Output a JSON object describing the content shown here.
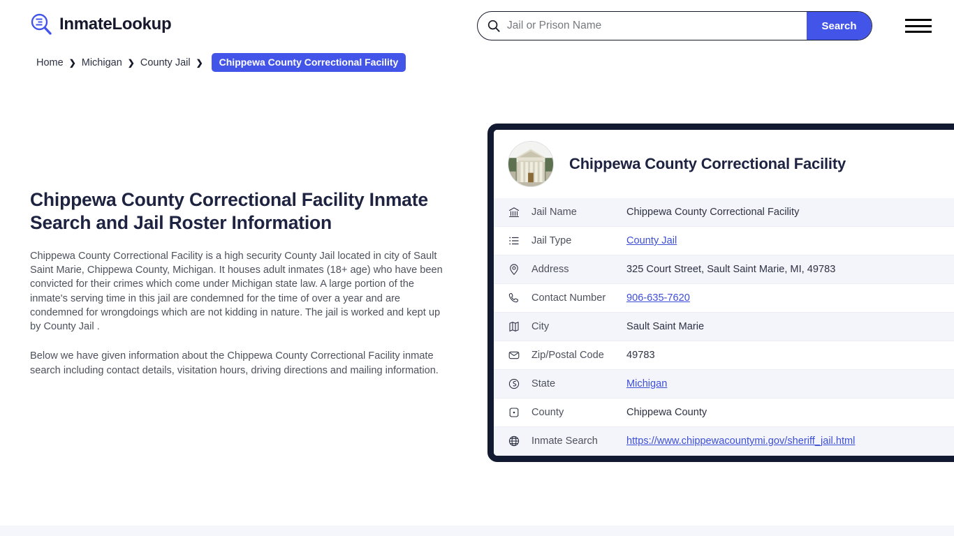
{
  "header": {
    "logo_text": "InmateLookup",
    "logo_icon": "magnifier-list-icon",
    "search": {
      "placeholder": "Jail or Prison Name",
      "value": "",
      "icon": "search-icon",
      "button_label": "Search"
    },
    "menu_icon": "hamburger-menu-icon"
  },
  "breadcrumb": {
    "items": [
      {
        "label": "Home"
      },
      {
        "label": "Michigan"
      },
      {
        "label": "County Jail"
      }
    ],
    "separator": "❯",
    "current": "Chippewa County Correctional Facility"
  },
  "main": {
    "page_title": "Chippewa County Correctional Facility Inmate Search and Jail Roster Information",
    "paragraph_1": "Chippewa County Correctional Facility is a high security County Jail located in city of Sault Saint Marie, Chippewa County, Michigan. It houses adult inmates (18+ age) who have been convicted for their crimes which come under Michigan state law. A large portion of the inmate's serving time in this jail are condemned for the time of over a year and are condemned for wrongdoings which are not kidding in nature. The jail is worked and kept up by County Jail .",
    "paragraph_2": "Below we have given information about the Chippewa County Correctional Facility inmate search including contact details, visitation hours, driving directions and mailing information."
  },
  "card": {
    "avatar_icon": "courthouse-photo",
    "title": "Chippewa County Correctional Facility",
    "rows": [
      {
        "icon": "bank-icon",
        "label": "Jail Name",
        "value": "Chippewa County Correctional Facility",
        "link": false
      },
      {
        "icon": "list-icon",
        "label": "Jail Type",
        "value": "County Jail",
        "link": true
      },
      {
        "icon": "map-pin-icon",
        "label": "Address",
        "value": "325 Court Street, Sault Saint Marie, MI, 49783",
        "link": false
      },
      {
        "icon": "phone-icon",
        "label": "Contact Number",
        "value": "906-635-7620",
        "link": true
      },
      {
        "icon": "map-icon",
        "label": "City",
        "value": "Sault Saint Marie",
        "link": false
      },
      {
        "icon": "envelope-icon",
        "label": "Zip/Postal Code",
        "value": "49783",
        "link": false
      },
      {
        "icon": "globe-state-icon",
        "label": "State",
        "value": "Michigan",
        "link": true
      },
      {
        "icon": "county-icon",
        "label": "County",
        "value": "Chippewa County",
        "link": false
      },
      {
        "icon": "globe-icon",
        "label": "Inmate Search",
        "value": "https://www.chippewacountymi.gov/sheriff_jail.html",
        "link": true
      }
    ]
  },
  "colors": {
    "accent_blue": "#4355e8",
    "link_blue": "#3d4fd6",
    "dark_navy": "#111a30",
    "heading_navy": "#1d2340",
    "row_alt": "#f4f5fb",
    "bottom_strip": "#f5f6fc"
  }
}
